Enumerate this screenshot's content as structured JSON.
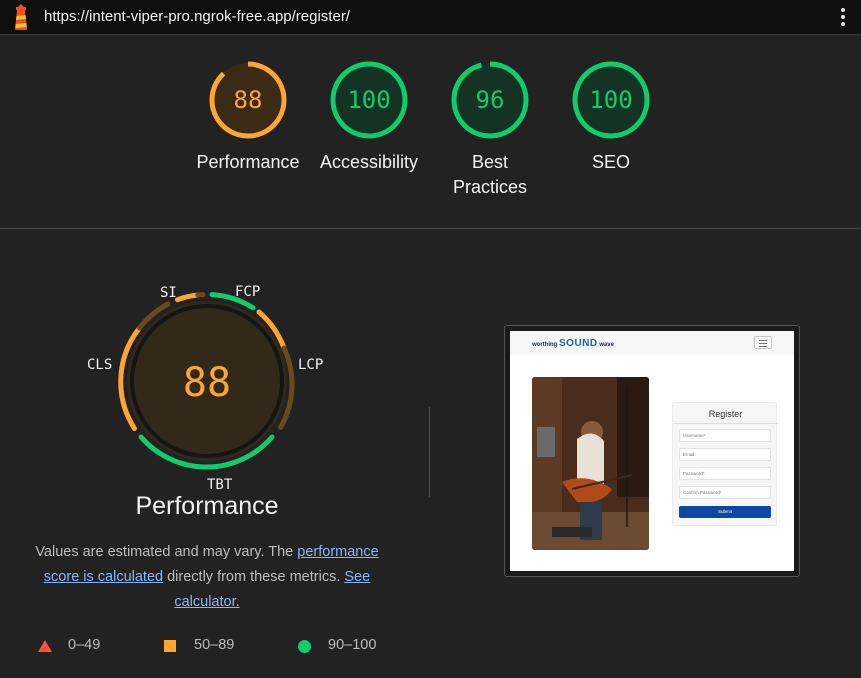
{
  "browser": {
    "url": "https://intent-viper-pro.ngrok-free.app/register/",
    "logo_icon": "lighthouse-icon",
    "menu_icon": "kebab-menu-icon"
  },
  "scores": [
    {
      "label": "Performance",
      "value": "88",
      "score": 0.88,
      "color": "#ffa632"
    },
    {
      "label": "Accessibility",
      "value": "100",
      "score": 1.0,
      "color": "#0cce6b"
    },
    {
      "label": "Best Practices",
      "value": "96",
      "score": 0.96,
      "color": "#0cce6b"
    },
    {
      "label": "SEO",
      "value": "100",
      "score": 1.0,
      "color": "#0cce6b"
    }
  ],
  "performance": {
    "title": "Performance",
    "score": "88",
    "metrics": {
      "si": "SI",
      "fcp": "FCP",
      "lcp": "LCP",
      "tbt": "TBT",
      "cls": "CLS"
    },
    "note_prefix": "Values are estimated and may vary. The ",
    "note_link1": "performance score is calculated",
    "note_middle": " directly from these metrics. ",
    "note_link2": "See calculator."
  },
  "legend": [
    {
      "range": "0–49",
      "shape": "triangle",
      "color": "#ff4e42"
    },
    {
      "range": "50–89",
      "shape": "square",
      "color": "#ffa632"
    },
    {
      "range": "90–100",
      "shape": "circle",
      "color": "#0cce6b"
    }
  ],
  "screenshot": {
    "brand_prefix": "worthing",
    "brand_main": "SOUND",
    "brand_suffix": "wave",
    "form_title": "Register",
    "fields": [
      "Username*",
      "Email",
      "Password*",
      "Confirm Password*"
    ],
    "submit_label": "Submit"
  }
}
